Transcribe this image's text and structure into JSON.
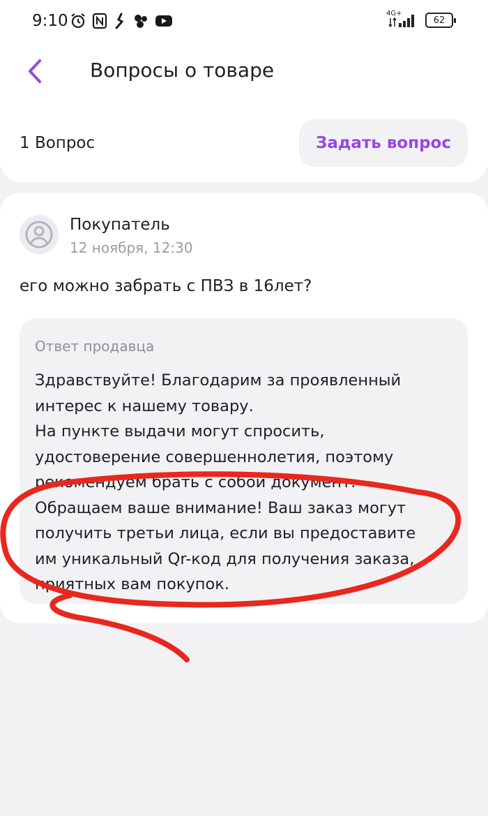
{
  "status_bar": {
    "time": "9:10",
    "network": "4G+",
    "battery": "62"
  },
  "header": {
    "title": "Вопросы о товаре",
    "count_label": "1 Вопрос",
    "ask_button": "Задать вопрос",
    "accent_color": "#9a47e0"
  },
  "question": {
    "author": "Покупатель",
    "date": "12 ноября, 12:30",
    "text": "его можно забрать с ПВЗ в 16лет?"
  },
  "answer": {
    "label": "Ответ продавца",
    "lines": [
      "Здравствуйте! Благодарим за проявленный",
      "интерес к нашему товару.",
      "На пункте выдачи могут спросить,",
      "удостоверение совершеннолетия, поэтому",
      "рекомендуем брать с собой документ.",
      "Обращаем ваше внимание! Ваш заказ могут",
      "получить третьи лица, если вы предоставите",
      "им уникальный Qr-код для получения заказа,",
      "приятных вам покупок."
    ]
  },
  "annotation_color": "#e8281e"
}
